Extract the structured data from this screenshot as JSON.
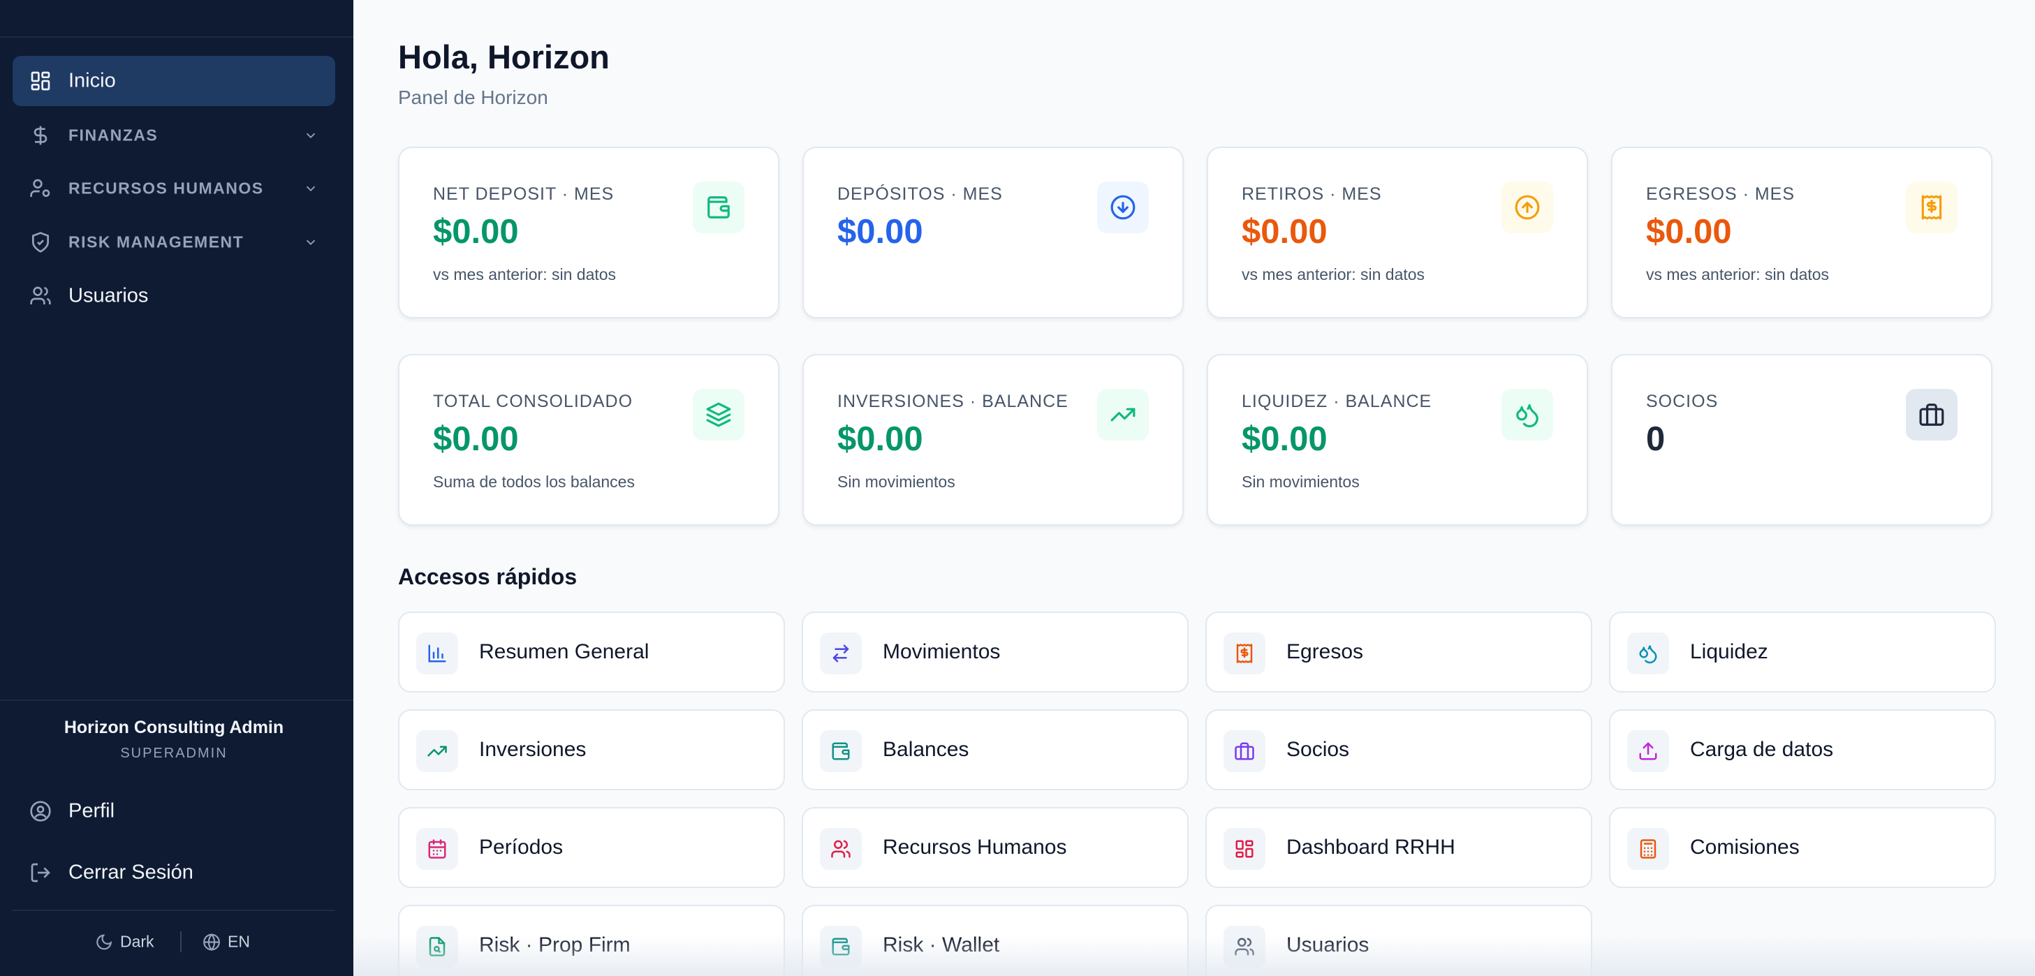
{
  "sidebar": {
    "nav": [
      {
        "label": "Inicio",
        "icon": "dashboard-icon",
        "active": true
      },
      {
        "label": "FINANZAS",
        "icon": "dollar-icon",
        "section": true
      },
      {
        "label": "RECURSOS HUMANOS",
        "icon": "user-gear-icon",
        "section": true
      },
      {
        "label": "RISK MANAGEMENT",
        "icon": "shield-check-icon",
        "section": true
      },
      {
        "label": "Usuarios",
        "icon": "users-icon"
      }
    ],
    "user": {
      "name": "Horizon Consulting Admin",
      "role": "SUPERADMIN"
    },
    "footer": [
      {
        "label": "Perfil",
        "icon": "user-circle-icon"
      },
      {
        "label": "Cerrar Sesión",
        "icon": "logout-icon"
      }
    ],
    "theme_label": "Dark",
    "lang_label": "EN"
  },
  "header": {
    "title": "Hola, Horizon",
    "subtitle": "Panel de Horizon"
  },
  "stats": [
    {
      "label": "NET DEPOSIT · MES",
      "value": "$0.00",
      "sub": "vs mes anterior: sin datos",
      "color": "#059669",
      "icon": "wallet-icon",
      "icon_color": "#10b981",
      "icon_bg": "#ecfdf5"
    },
    {
      "label": "DEPÓSITOS · MES",
      "value": "$0.00",
      "sub": "",
      "color": "#2563eb",
      "icon": "arrow-down-circle-icon",
      "icon_color": "#2563eb",
      "icon_bg": "#eff6ff"
    },
    {
      "label": "RETIROS · MES",
      "value": "$0.00",
      "sub": "vs mes anterior: sin datos",
      "color": "#ea580c",
      "icon": "arrow-up-circle-icon",
      "icon_color": "#f59e0b",
      "icon_bg": "#fffbeb"
    },
    {
      "label": "EGRESOS · MES",
      "value": "$0.00",
      "sub": "vs mes anterior: sin datos",
      "color": "#ea580c",
      "icon": "receipt-icon",
      "icon_color": "#f59e0b",
      "icon_bg": "#fffbeb"
    },
    {
      "label": "TOTAL CONSOLIDADO",
      "value": "$0.00",
      "sub": "Suma de todos los balances",
      "color": "#059669",
      "icon": "layers-icon",
      "icon_color": "#10b981",
      "icon_bg": "#ecfdf5"
    },
    {
      "label": "INVERSIONES · BALANCE",
      "value": "$0.00",
      "sub": "Sin movimientos",
      "color": "#059669",
      "icon": "trending-up-icon",
      "icon_color": "#10b981",
      "icon_bg": "#ecfdf5"
    },
    {
      "label": "LIQUIDEZ · BALANCE",
      "value": "$0.00",
      "sub": "Sin movimientos",
      "color": "#059669",
      "icon": "droplets-icon",
      "icon_color": "#10b981",
      "icon_bg": "#ecfdf5"
    },
    {
      "label": "SOCIOS",
      "value": "0",
      "sub": "",
      "color": "#1e293b",
      "icon": "briefcase-icon",
      "icon_color": "#1e293b",
      "icon_bg": "#e2e8f0"
    }
  ],
  "quick_title": "Accesos rápidos",
  "quick": [
    {
      "label": "Resumen General",
      "icon": "bar-chart-icon",
      "color": "#2563eb"
    },
    {
      "label": "Movimientos",
      "icon": "arrows-exchange-icon",
      "color": "#4f46e5"
    },
    {
      "label": "Egresos",
      "icon": "receipt-icon",
      "color": "#ea580c"
    },
    {
      "label": "Liquidez",
      "icon": "droplets-icon",
      "color": "#0891b2"
    },
    {
      "label": "Inversiones",
      "icon": "trending-up-icon",
      "color": "#059669"
    },
    {
      "label": "Balances",
      "icon": "wallet-icon",
      "color": "#0d9488"
    },
    {
      "label": "Socios",
      "icon": "briefcase-icon",
      "color": "#7c3aed"
    },
    {
      "label": "Carga de datos",
      "icon": "upload-icon",
      "color": "#c026d3"
    },
    {
      "label": "Períodos",
      "icon": "calendar-icon",
      "color": "#db2777"
    },
    {
      "label": "Recursos Humanos",
      "icon": "users-icon",
      "color": "#e11d48"
    },
    {
      "label": "Dashboard RRHH",
      "icon": "dashboard-icon",
      "color": "#e11d48"
    },
    {
      "label": "Comisiones",
      "icon": "calculator-icon",
      "color": "#ea580c"
    },
    {
      "label": "Risk · Prop Firm",
      "icon": "file-search-icon",
      "color": "#059669"
    },
    {
      "label": "Risk · Wallet",
      "icon": "wallet-icon",
      "color": "#0d9488"
    },
    {
      "label": "Usuarios",
      "icon": "users-icon",
      "color": "#475569"
    }
  ]
}
